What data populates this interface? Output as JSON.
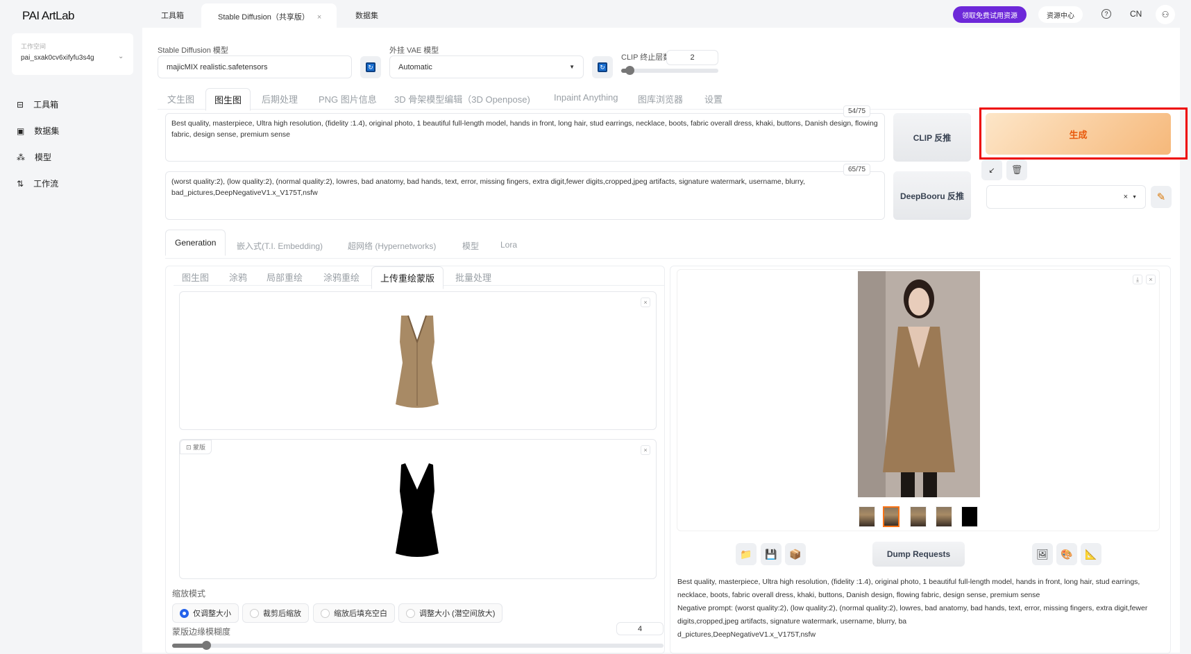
{
  "header": {
    "logo": "PAI ArtLab",
    "tabs": [
      "工具箱",
      "Stable Diffusion（共享版）",
      "数据集"
    ],
    "tab_close": "×",
    "promo_button": "领取免费试用资源",
    "resource_center": "资源中心",
    "help": "?",
    "lang": "CN"
  },
  "sidebar": {
    "workspace_label": "工作空间",
    "workspace_value": "pai_sxak0cv6xifyfu3s4g",
    "items": [
      "工具箱",
      "数据集",
      "模型",
      "工作流"
    ]
  },
  "top": {
    "sd_model_label": "Stable Diffusion 模型",
    "sd_model_value": "majicMIX realistic.safetensors",
    "vae_label": "外挂 VAE 模型",
    "vae_value": "Automatic",
    "clip_label": "CLIP 终止层数",
    "clip_value": "2",
    "clip_slider_fraction": 0.08
  },
  "main_tabs": [
    "文生图",
    "图生图",
    "后期处理",
    "PNG 图片信息",
    "3D 骨架模型编辑（3D Openpose)",
    "Inpaint Anything",
    "图库浏览器",
    "设置"
  ],
  "prompt": {
    "text": "Best quality, masterpiece, Ultra high resolution, (fidelity :1.4), original photo, 1 beautiful full-length model, hands in front, long hair, stud earrings, necklace, boots, fabric overall dress, khaki, buttons, Danish design, flowing fabric, design sense, premium sense",
    "count": "54/75"
  },
  "negative": {
    "text": "(worst quality:2), (low quality:2), (normal quality:2), lowres, bad anatomy, bad hands, text, error, missing fingers, extra digit,fewer digits,cropped,jpeg artifacts, signature watermark, username, blurry, bad_pictures,DeepNegativeV1.x_V175T,nsfw",
    "count": "65/75"
  },
  "actions": {
    "clip_interrogate": "CLIP 反推",
    "deepbooru": "DeepBooru 反推",
    "generate": "生成",
    "generate_color": "#f6b87a"
  },
  "gen_tabs": [
    "Generation",
    "嵌入式(T.I. Embedding)",
    "超网络 (Hypernetworks)",
    "模型",
    "Lora"
  ],
  "sub_tabs": [
    "图生图",
    "涂鸦",
    "局部重绘",
    "涂鸦重绘",
    "上传重绘蒙版",
    "批量处理"
  ],
  "mask_label": "蒙版",
  "resize": {
    "label": "缩放模式",
    "options": [
      "仅调整大小",
      "裁剪后缩放",
      "缩放后填充空白",
      "调整大小 (潜空间放大)"
    ],
    "selected": 0
  },
  "blur": {
    "label": "蒙版边缘模糊度",
    "value": "4",
    "slider_fraction": 0.07
  },
  "output": {
    "dump": "Dump Requests",
    "info_line1": "Best quality, masterpiece, Ultra high resolution, (fidelity :1.4), original photo, 1 beautiful full-length model, hands in front, long hair, stud earrings, necklace, boots, fabric overall dress, khaki, buttons, Danish design, flowing fabric, design sense, premium sense",
    "info_line2": "Negative prompt: (worst quality:2), (low quality:2), (normal quality:2), lowres, bad anatomy, bad hands, text, error, missing fingers, extra digit,fewer digits,cropped,jpeg artifacts, signature watermark, username, blurry, ba",
    "info_line3": "d_pictures,DeepNegativeV1.x_V175T,nsfw"
  }
}
